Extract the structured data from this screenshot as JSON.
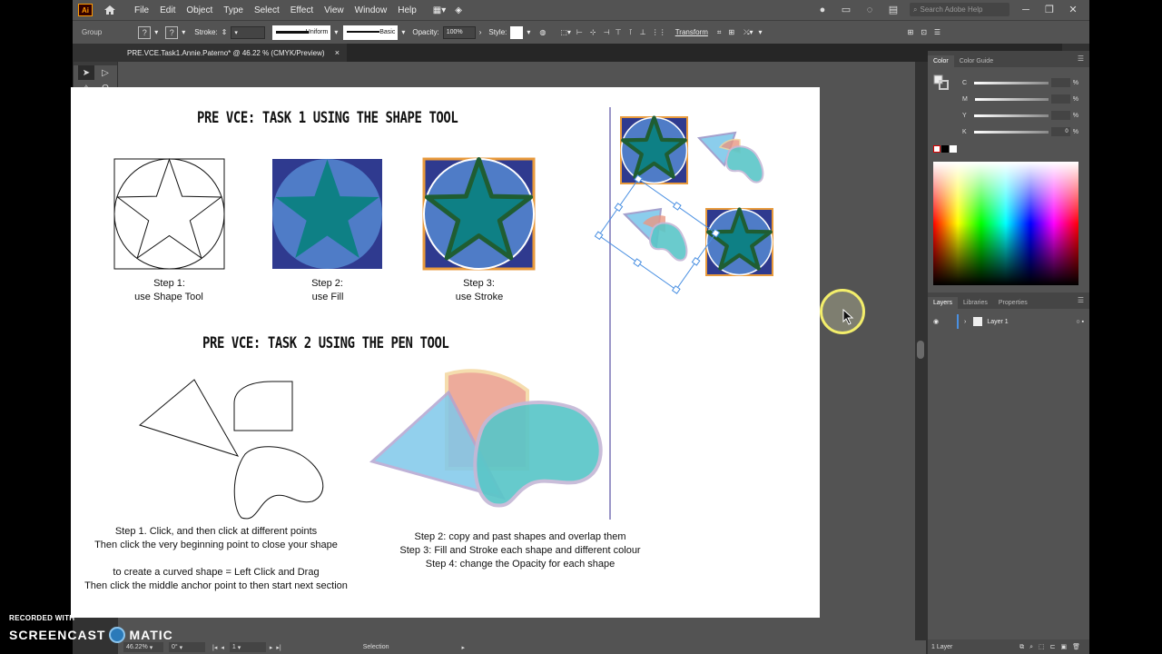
{
  "menu": {
    "logo": "Ai",
    "items": [
      "File",
      "Edit",
      "Object",
      "Type",
      "Select",
      "Effect",
      "View",
      "Window",
      "Help"
    ],
    "search_placeholder": "Search Adobe Help"
  },
  "control": {
    "selection_type": "Group",
    "stroke_label": "Stroke:",
    "stroke_profile": "Uniform",
    "brush": "Basic",
    "opacity_label": "Opacity:",
    "opacity_value": "100%",
    "style_label": "Style:",
    "transform_label": "Transform"
  },
  "document": {
    "tab_title": "PRE.VCE.Task1.Annie.Paterno* @ 46.22 % (CMYK/Preview)",
    "close": "×"
  },
  "artwork": {
    "task1_heading": "PRE VCE: TASK 1 USING THE SHAPE TOOL",
    "task2_heading": "PRE VCE: TASK 2 USING THE PEN TOOL",
    "step1_title": "Step 1:",
    "step1_sub": "use Shape Tool",
    "step2_title": "Step 2:",
    "step2_sub": "use Fill",
    "step3_title": "Step 3:",
    "step3_sub": "use Stroke",
    "pen_left_1": "Step 1. Click, and then click at different points",
    "pen_left_2": "Then click the very beginning point to close your shape",
    "pen_left_3": "to create a curved shape = Left Click and Drag",
    "pen_left_4": "Then click the middle anchor point to then start next section",
    "pen_right_1": "Step 2: copy and past shapes and overlap them",
    "pen_right_2": "Step 3: Fill and Stroke each shape and different colour",
    "pen_right_3": "Step 4: change the Opacity for each shape"
  },
  "color_panel": {
    "tabs": [
      "Color",
      "Color Guide"
    ],
    "rows": [
      {
        "label": "C",
        "value": ""
      },
      {
        "label": "M",
        "value": ""
      },
      {
        "label": "Y",
        "value": ""
      },
      {
        "label": "K",
        "value": "0"
      }
    ],
    "pct": "%"
  },
  "layers_panel": {
    "tabs": [
      "Layers",
      "Libraries",
      "Properties"
    ],
    "layer_name": "Layer 1",
    "footer": "1 Layer"
  },
  "status": {
    "zoom": "46.22%",
    "rotation": "0°",
    "artboard": "1",
    "tool": "Selection"
  },
  "watermark": {
    "recorded": "RECORDED WITH",
    "brand_left": "SCREENCAST",
    "brand_right": "MATIC"
  },
  "colors": {
    "navy": "#2f3a8f",
    "fill_blue": "#4f7cc7",
    "teal": "#0e8085",
    "stroke_green": "#1f5d32",
    "orange": "#e89a3c",
    "light_blue": "#7fc8ea",
    "salmon": "#e99783",
    "aqua": "#5ac6c8",
    "guide_purple": "#9b96c8"
  }
}
